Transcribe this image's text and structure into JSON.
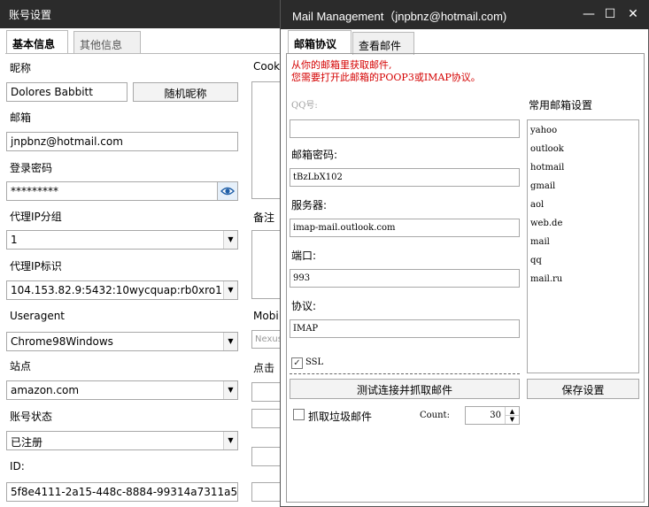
{
  "account_window": {
    "title": "账号设置",
    "tabs": [
      "基本信息",
      "其他信息"
    ],
    "nickname": {
      "label": "昵称",
      "value": "Dolores Babbitt",
      "random_button": "随机昵称"
    },
    "email": {
      "label": "邮箱",
      "value": "jnpbnz@hotmail.com"
    },
    "password": {
      "label": "登录密码",
      "value": "*********"
    },
    "proxy_group": {
      "label": "代理IP分组",
      "value": "1"
    },
    "proxy_id": {
      "label": "代理IP标识",
      "value": "104.153.82.9:5432:10wycquap:rb0xro1"
    },
    "useragent": {
      "label": "Useragent",
      "value": "Chrome98Windows"
    },
    "site": {
      "label": "站点",
      "value": "amazon.com"
    },
    "status": {
      "label": "账号状态",
      "value": "已注册"
    },
    "id": {
      "label": "ID:",
      "value": "5f8e4111-2a15-448c-8884-99314a7311a5"
    },
    "right_column": {
      "cookie_label": "Cook",
      "notes_label": "备注",
      "mobile_label": "Mobi",
      "mobile_value": "Nexus",
      "click_label": "点击"
    }
  },
  "mail_window": {
    "title": "Mail Management（jnpbnz@hotmail.com)",
    "controls": {
      "minimize": "—",
      "maximize": "☐",
      "close": "✕"
    },
    "tabs": [
      "邮箱协议",
      "查看邮件"
    ],
    "notice": [
      "从你的邮箱里获取邮件,",
      "您需要打开此邮箱的POOP3或IMAP协议。"
    ],
    "qq": {
      "label": "QQ号:",
      "value": ""
    },
    "mail_password": {
      "label": "邮箱密码:",
      "value": "tBzLbX102"
    },
    "server": {
      "label": "服务器:",
      "value": "imap-mail.outlook.com"
    },
    "port": {
      "label": "端口:",
      "value": "993"
    },
    "protocol": {
      "label": "协议:",
      "value": "IMAP"
    },
    "ssl": {
      "label": "SSL",
      "checked": true
    },
    "test_button": "测试连接并抓取邮件",
    "junk": {
      "label": "抓取垃圾邮件",
      "checked": false
    },
    "count": {
      "label": "Count:",
      "value": "30"
    },
    "presets": {
      "label": "常用邮箱设置",
      "items": [
        "yahoo",
        "outlook",
        "hotmail",
        "gmail",
        "aol",
        "web.de",
        "mail",
        "qq",
        "mail.ru"
      ]
    },
    "save_button": "保存设置"
  },
  "colors": {
    "titlebar": "#2b2b2b",
    "notice": "#d40000",
    "disabled_label": "#a0a0a0"
  }
}
